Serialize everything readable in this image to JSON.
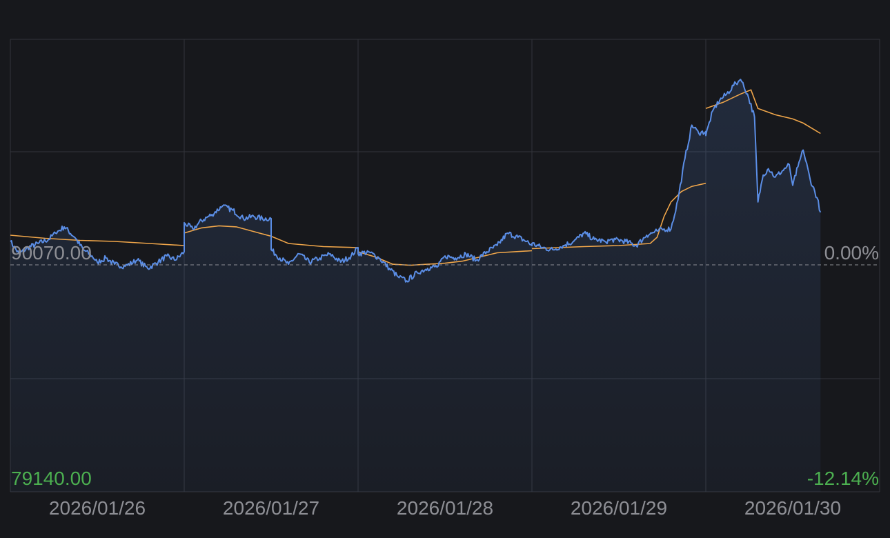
{
  "colors": {
    "background": "#17181c",
    "grid": "#33353b",
    "price_line": "#5b8ee6",
    "avg_line": "#f0a64a",
    "fill": "#5b8ee6",
    "label_neutral": "#8e8f95",
    "label_down": "#4caf50",
    "reference_line": "#8e8f95"
  },
  "chart_data": {
    "type": "line",
    "title": "",
    "xlabel": "",
    "ylabel": "",
    "grid": true,
    "x_tick_labels": [
      "2026/01/26",
      "2026/01/27",
      "2026/01/28",
      "2026/01/29",
      "2026/01/30"
    ],
    "reference_price_label": "90070.00",
    "reference_percent_label": "0.00%",
    "low_price_label": "79140.00",
    "low_percent_label": "-12.14%",
    "reference_price": 90070,
    "ylim": [
      79140,
      99000
    ],
    "session_breaks": [
      "2026/01/26",
      "2026/01/27",
      "2026/01/28",
      "2026/01/29"
    ],
    "series": [
      {
        "key": "price",
        "x": [
          0,
          0.05,
          0.1,
          0.16,
          0.22,
          0.26,
          0.31,
          0.37,
          0.42,
          0.47,
          0.5,
          0.55,
          0.6,
          0.66,
          0.73,
          0.79,
          0.85,
          0.9,
          0.95,
          1.0,
          1.0,
          1.05,
          1.1,
          1.16,
          1.22,
          1.28,
          1.34,
          1.4,
          1.45,
          1.5,
          1.5,
          1.55,
          1.6,
          1.66,
          1.72,
          1.78,
          1.84,
          1.9,
          1.96,
          2.0,
          2.0,
          2.06,
          2.12,
          2.18,
          2.23,
          2.28,
          2.34,
          2.4,
          2.46,
          2.5,
          2.56,
          2.62,
          2.68,
          2.74,
          2.8,
          2.86,
          2.92,
          2.97,
          3.0,
          3.0,
          3.06,
          3.12,
          3.18,
          3.24,
          3.3,
          3.36,
          3.42,
          3.48,
          3.54,
          3.6,
          3.66,
          3.72,
          3.76,
          3.8,
          3.84,
          3.88,
          3.92,
          3.96,
          4.0,
          4.0,
          4.04,
          4.08,
          4.12,
          4.16,
          4.2,
          4.24,
          4.28,
          4.3,
          4.33,
          4.36,
          4.4,
          4.44,
          4.48,
          4.5,
          4.53,
          4.56,
          4.6,
          4.64,
          4.66
        ],
        "values": [
          91200,
          90600,
          90900,
          91100,
          91300,
          91600,
          91900,
          91400,
          90800,
          90500,
          90200,
          90400,
          90100,
          90000,
          90300,
          89900,
          90200,
          90500,
          90300,
          90700,
          92100,
          91800,
          92200,
          92500,
          92900,
          92700,
          92300,
          92400,
          92300,
          92300,
          90800,
          90400,
          90100,
          90600,
          90200,
          90400,
          90600,
          90200,
          90500,
          90900,
          90600,
          90700,
          90400,
          89900,
          89500,
          89300,
          89700,
          89900,
          90000,
          90500,
          90400,
          90600,
          90300,
          90700,
          91000,
          91600,
          91400,
          91200,
          91000,
          91100,
          90900,
          90800,
          91000,
          91200,
          91600,
          91300,
          91200,
          91300,
          91200,
          91000,
          91500,
          91700,
          91800,
          91800,
          93200,
          95200,
          96800,
          96400,
          96500,
          96300,
          97500,
          98000,
          98300,
          98700,
          99000,
          98300,
          97200,
          93100,
          94400,
          94700,
          94300,
          94600,
          94900,
          93900,
          94800,
          95600,
          94200,
          93300,
          92600
        ]
      },
      {
        "key": "average",
        "segments": [
          {
            "x": [
              0,
              0.2,
              0.4,
              0.6,
              0.8,
              1.0
            ],
            "values": [
              91500,
              91350,
              91250,
              91200,
              91100,
              91000
            ]
          },
          {
            "x": [
              1.0,
              1.1,
              1.2,
              1.3,
              1.5,
              1.6,
              1.8,
              2.0
            ],
            "values": [
              91600,
              91850,
              91950,
              91900,
              91450,
              91100,
              90950,
              90900
            ]
          },
          {
            "x": [
              2.0,
              2.1,
              2.2,
              2.3,
              2.4,
              2.5,
              2.6,
              2.7,
              2.8,
              3.0
            ],
            "values": [
              90700,
              90450,
              90100,
              90050,
              90100,
              90150,
              90250,
              90450,
              90650,
              90750
            ]
          },
          {
            "x": [
              3.0,
              3.3,
              3.5,
              3.68,
              3.72,
              3.76,
              3.8,
              3.86,
              3.92,
              4.0
            ],
            "values": [
              90850,
              90950,
              91000,
              91100,
              91400,
              92400,
              93100,
              93600,
              93850,
              94000
            ]
          },
          {
            "x": [
              4.0,
              4.1,
              4.2,
              4.26,
              4.3,
              4.4,
              4.5,
              4.56,
              4.62,
              4.66
            ],
            "values": [
              97600,
              97900,
              98300,
              98500,
              97600,
              97300,
              97100,
              96900,
              96600,
              96400
            ]
          }
        ]
      }
    ]
  }
}
